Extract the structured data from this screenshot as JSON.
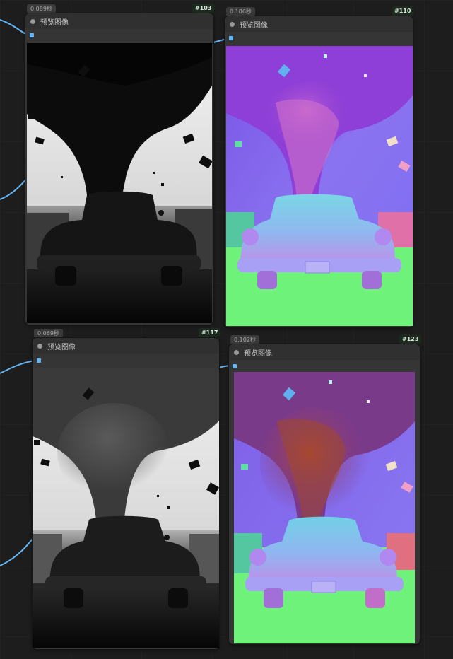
{
  "nodes": [
    {
      "id": "#103",
      "title": "预览图像",
      "timing": "0.089秒",
      "mode": "depth"
    },
    {
      "id": "#110",
      "title": "预览图像",
      "timing": "0.106秒",
      "mode": "normal"
    },
    {
      "id": "#117",
      "title": "预览图像",
      "timing": "0.069秒",
      "mode": "depth"
    },
    {
      "id": "#123",
      "title": "预览图像",
      "timing": "0.102秒",
      "mode": "normal"
    }
  ],
  "colors": {
    "canvas": "#1d1d1d",
    "node_body": "#353535",
    "node_header": "#303030",
    "link": "#64b5f6",
    "badge_bg": "#1b2a1e"
  },
  "icons": [
    "collapse-dot-icon",
    "image-input-port-icon"
  ]
}
